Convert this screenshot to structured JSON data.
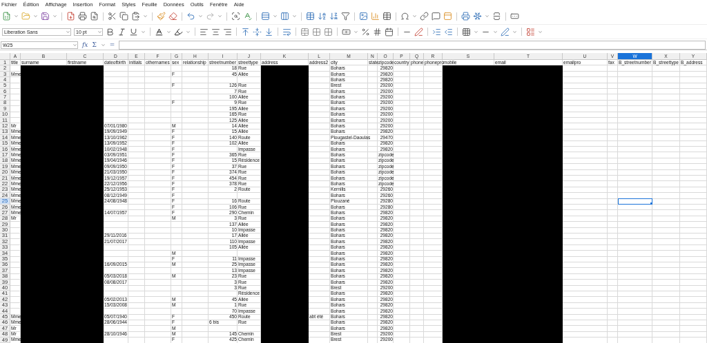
{
  "menu": [
    "Fichier",
    "Édition",
    "Affichage",
    "Insertion",
    "Format",
    "Styles",
    "Feuille",
    "Données",
    "Outils",
    "Fenêtre",
    "Aide"
  ],
  "formatting": {
    "font_name": "Liberation Sans",
    "font_size": "10 pt"
  },
  "formula_bar": {
    "name_box": "W25",
    "function_wizard": "fx",
    "sum": "Σ",
    "equals": "="
  },
  "columns": [
    {
      "letter": "A",
      "selected": false,
      "redacted": false
    },
    {
      "letter": "B",
      "selected": false,
      "redacted": true
    },
    {
      "letter": "C",
      "selected": false,
      "redacted": true
    },
    {
      "letter": "D",
      "selected": false,
      "redacted": false
    },
    {
      "letter": "E",
      "selected": false,
      "redacted": false
    },
    {
      "letter": "F",
      "selected": false,
      "redacted": false
    },
    {
      "letter": "G",
      "selected": false,
      "redacted": false
    },
    {
      "letter": "H",
      "selected": false,
      "redacted": false
    },
    {
      "letter": "I",
      "selected": false,
      "redacted": false
    },
    {
      "letter": "J",
      "selected": false,
      "redacted": false
    },
    {
      "letter": "K",
      "selected": false,
      "redacted": true
    },
    {
      "letter": "L",
      "selected": false,
      "redacted": false
    },
    {
      "letter": "M",
      "selected": false,
      "redacted": false
    },
    {
      "letter": "N",
      "selected": false,
      "redacted": false
    },
    {
      "letter": "O",
      "selected": false,
      "redacted": false
    },
    {
      "letter": "P",
      "selected": false,
      "redacted": false
    },
    {
      "letter": "Q",
      "selected": false,
      "redacted": false
    },
    {
      "letter": "R",
      "selected": false,
      "redacted": false
    },
    {
      "letter": "S",
      "selected": false,
      "redacted": true
    },
    {
      "letter": "T",
      "selected": false,
      "redacted": true
    },
    {
      "letter": "U",
      "selected": false,
      "redacted": false
    },
    {
      "letter": "V",
      "selected": false,
      "redacted": false
    },
    {
      "letter": "W",
      "selected": true,
      "redacted": false
    },
    {
      "letter": "X",
      "selected": false,
      "redacted": false
    },
    {
      "letter": "Y",
      "selected": false,
      "redacted": false
    }
  ],
  "header_row": {
    "number": "1",
    "selected": false,
    "cells": [
      "title",
      "surname",
      "firstname",
      "dateofbirth",
      "initials",
      "othernames",
      "sex",
      "relationship",
      "streetnumber",
      "streettype",
      "address",
      "address2",
      "city",
      "state",
      "zipcode",
      "country",
      "phone",
      "phonepro",
      "mobile",
      "email",
      "emailpro",
      "fax",
      "B_streetnumber",
      "B_streettype",
      "B_address"
    ]
  },
  "rows": [
    {
      "number": "2",
      "selected": false,
      "cells": [
        null,
        null,
        null,
        null,
        null,
        null,
        null,
        null,
        "18",
        "Rue",
        null,
        null,
        "Bohars",
        null,
        "29820",
        null,
        null,
        null,
        null,
        null,
        null,
        null,
        null,
        null,
        null
      ]
    },
    {
      "number": "3",
      "selected": false,
      "cells": [
        "Mme",
        null,
        null,
        null,
        null,
        null,
        "F",
        null,
        "45",
        "Allée",
        null,
        null,
        "Bohars",
        null,
        "29820",
        null,
        null,
        null,
        null,
        null,
        null,
        null,
        null,
        null,
        null
      ]
    },
    {
      "number": "4",
      "selected": false,
      "cells": [
        null,
        null,
        null,
        null,
        null,
        null,
        null,
        null,
        null,
        null,
        null,
        null,
        "Bohars",
        null,
        "29820",
        null,
        null,
        null,
        null,
        null,
        null,
        null,
        null,
        null,
        null
      ]
    },
    {
      "number": "5",
      "selected": false,
      "cells": [
        null,
        null,
        null,
        null,
        null,
        null,
        "F",
        null,
        "126",
        "Rue",
        null,
        null,
        "Brest",
        null,
        "29200",
        null,
        null,
        null,
        null,
        null,
        null,
        null,
        null,
        null,
        null
      ]
    },
    {
      "number": "6",
      "selected": false,
      "cells": [
        null,
        null,
        null,
        null,
        null,
        null,
        null,
        null,
        "7",
        "Rue",
        null,
        null,
        "Bohars",
        null,
        "29200",
        null,
        null,
        null,
        null,
        null,
        null,
        null,
        null,
        null,
        null
      ]
    },
    {
      "number": "7",
      "selected": false,
      "cells": [
        null,
        null,
        null,
        null,
        null,
        null,
        null,
        null,
        "100",
        "Allée",
        null,
        null,
        "Bohars",
        null,
        "29200",
        null,
        null,
        null,
        null,
        null,
        null,
        null,
        null,
        null,
        null
      ]
    },
    {
      "number": "8",
      "selected": false,
      "cells": [
        null,
        null,
        null,
        null,
        null,
        null,
        "F",
        null,
        "9",
        "Rue",
        null,
        null,
        "Bohars",
        null,
        "29200",
        null,
        null,
        null,
        null,
        null,
        null,
        null,
        null,
        null,
        null
      ]
    },
    {
      "number": "9",
      "selected": false,
      "cells": [
        null,
        null,
        null,
        null,
        null,
        null,
        null,
        null,
        "195",
        "Allée",
        null,
        null,
        "Bohars",
        null,
        "29200",
        null,
        null,
        null,
        null,
        null,
        null,
        null,
        null,
        null,
        null
      ]
    },
    {
      "number": "10",
      "selected": false,
      "cells": [
        null,
        null,
        null,
        null,
        null,
        null,
        null,
        null,
        "165",
        "Rue",
        null,
        null,
        "Bohars",
        null,
        "29200",
        null,
        null,
        null,
        null,
        null,
        null,
        null,
        null,
        null,
        null
      ]
    },
    {
      "number": "11",
      "selected": false,
      "cells": [
        null,
        null,
        null,
        null,
        null,
        null,
        null,
        null,
        "125",
        "Allée",
        null,
        null,
        "Bohars",
        null,
        "29200",
        null,
        null,
        null,
        null,
        null,
        null,
        null,
        null,
        null,
        null
      ]
    },
    {
      "number": "12",
      "selected": false,
      "cells": [
        "Mr",
        null,
        null,
        "07/01/1980",
        null,
        null,
        "M",
        null,
        "14",
        "Allée",
        null,
        null,
        "Bohars",
        null,
        "29200",
        null,
        null,
        null,
        null,
        null,
        null,
        null,
        null,
        null,
        null
      ]
    },
    {
      "number": "13",
      "selected": false,
      "cells": [
        "Mme",
        null,
        null,
        "19/09/1949",
        null,
        null,
        "F",
        null,
        "15",
        "Allée",
        null,
        null,
        "Bohars",
        null,
        "29820",
        null,
        null,
        null,
        null,
        null,
        null,
        null,
        null,
        null,
        null
      ]
    },
    {
      "number": "14",
      "selected": false,
      "cells": [
        "Mme",
        null,
        null,
        "13/10/1962",
        null,
        null,
        "F",
        null,
        "140",
        "Route",
        null,
        null,
        "Plougastel-Daoulas",
        null,
        "29470",
        null,
        null,
        null,
        null,
        null,
        null,
        null,
        null,
        null,
        null
      ]
    },
    {
      "number": "15",
      "selected": false,
      "cells": [
        "Mme",
        null,
        null,
        "13/09/1952",
        null,
        null,
        "F",
        null,
        "102",
        "Allée",
        null,
        null,
        "Bohars",
        null,
        "29820",
        null,
        null,
        null,
        null,
        null,
        null,
        null,
        null,
        null,
        null
      ]
    },
    {
      "number": "16",
      "selected": false,
      "cells": [
        "Mme",
        null,
        null,
        "10/02/1948",
        null,
        null,
        "F",
        null,
        null,
        "Impasse",
        null,
        null,
        "Bohars",
        null,
        "29820",
        null,
        null,
        null,
        null,
        null,
        null,
        null,
        null,
        null,
        null
      ]
    },
    {
      "number": "17",
      "selected": false,
      "cells": [
        "Mme",
        null,
        null,
        "03/09/1951",
        null,
        null,
        "F",
        null,
        "365",
        "Rue",
        null,
        null,
        "Bohars",
        null,
        "zipcode",
        null,
        null,
        null,
        null,
        null,
        null,
        null,
        null,
        null,
        null
      ]
    },
    {
      "number": "18",
      "selected": false,
      "cells": [
        "Mme",
        null,
        null,
        "19/04/1946",
        null,
        null,
        "F",
        null,
        "15",
        "Résidence",
        null,
        null,
        "Bohars",
        null,
        "zipcode",
        null,
        null,
        null,
        null,
        null,
        null,
        null,
        null,
        null,
        null
      ]
    },
    {
      "number": "19",
      "selected": false,
      "cells": [
        "Mme",
        null,
        null,
        "09/09/1950",
        null,
        null,
        "F",
        null,
        "37",
        "Rue",
        null,
        null,
        "Bohars",
        null,
        "zipcode",
        null,
        null,
        null,
        null,
        null,
        null,
        null,
        null,
        null,
        null
      ]
    },
    {
      "number": "20",
      "selected": false,
      "cells": [
        "Mme",
        null,
        null,
        "21/03/1950",
        null,
        null,
        "F",
        null,
        "374",
        "Rue",
        null,
        null,
        "Bohars",
        null,
        "zipcode",
        null,
        null,
        null,
        null,
        null,
        null,
        null,
        null,
        null,
        null
      ]
    },
    {
      "number": "21",
      "selected": false,
      "cells": [
        "Mme",
        null,
        null,
        "19/12/1957",
        null,
        null,
        "F",
        null,
        "454",
        "Rue",
        null,
        null,
        "Bohars",
        null,
        "zipcode",
        null,
        null,
        null,
        null,
        null,
        null,
        null,
        null,
        null,
        null
      ]
    },
    {
      "number": "22",
      "selected": false,
      "cells": [
        "Mme",
        null,
        null,
        "22/12/1956",
        null,
        null,
        "F",
        null,
        "378",
        "Rue",
        null,
        null,
        "Bohars",
        null,
        "zipcode",
        null,
        null,
        null,
        null,
        null,
        null,
        null,
        null,
        null,
        null
      ]
    },
    {
      "number": "23",
      "selected": false,
      "cells": [
        "Mme",
        null,
        null,
        "25/12/1953",
        null,
        null,
        "F",
        null,
        "2",
        "Route",
        null,
        null,
        "Kernilis",
        null,
        "29260",
        null,
        null,
        null,
        null,
        null,
        null,
        null,
        null,
        null,
        null
      ]
    },
    {
      "number": "24",
      "selected": false,
      "cells": [
        "Mme",
        null,
        null,
        "08/12/1949",
        null,
        null,
        "F",
        null,
        null,
        null,
        null,
        null,
        "Bohars",
        null,
        "29260",
        null,
        null,
        null,
        null,
        null,
        null,
        null,
        null,
        null,
        null
      ]
    },
    {
      "number": "25",
      "selected": true,
      "cells": [
        "Mme",
        null,
        null,
        "24/08/1948",
        null,
        null,
        "F",
        null,
        "16",
        "Route",
        null,
        null,
        "Plouzané",
        null,
        "29280",
        null,
        null,
        null,
        null,
        null,
        null,
        null,
        null,
        null,
        null
      ]
    },
    {
      "number": "26",
      "selected": false,
      "cells": [
        "Mme",
        null,
        null,
        null,
        null,
        null,
        "F",
        null,
        "106",
        "Rue",
        null,
        null,
        "Bohars",
        null,
        "29280",
        null,
        null,
        null,
        null,
        null,
        null,
        null,
        null,
        null,
        null
      ]
    },
    {
      "number": "27",
      "selected": false,
      "cells": [
        "Mme",
        null,
        null,
        "14/07/1957",
        null,
        null,
        "F",
        null,
        "290",
        "Chemin",
        null,
        null,
        "Bohars",
        null,
        "29820",
        null,
        null,
        null,
        null,
        null,
        null,
        null,
        null,
        null,
        null
      ]
    },
    {
      "number": "28",
      "selected": false,
      "cells": [
        "Mr",
        null,
        null,
        null,
        null,
        null,
        "M",
        null,
        "3",
        "Rue",
        null,
        null,
        "Bohars",
        null,
        "29820",
        null,
        null,
        null,
        null,
        null,
        null,
        null,
        null,
        null,
        null
      ]
    },
    {
      "number": "29",
      "selected": false,
      "cells": [
        null,
        null,
        null,
        null,
        null,
        null,
        null,
        null,
        "137",
        "Allée",
        null,
        null,
        "Bohars",
        null,
        "29820",
        null,
        null,
        null,
        null,
        null,
        null,
        null,
        null,
        null,
        null
      ]
    },
    {
      "number": "30",
      "selected": false,
      "cells": [
        null,
        null,
        null,
        null,
        null,
        null,
        null,
        null,
        "10",
        "Impasse",
        null,
        null,
        "Bohars",
        null,
        "29820",
        null,
        null,
        null,
        null,
        null,
        null,
        null,
        null,
        null,
        null
      ]
    },
    {
      "number": "31",
      "selected": false,
      "cells": [
        null,
        null,
        null,
        "29/11/2016",
        null,
        null,
        null,
        null,
        "17",
        "Allée",
        null,
        null,
        "Bohars",
        null,
        "29820",
        null,
        null,
        null,
        null,
        null,
        null,
        null,
        null,
        null,
        null
      ]
    },
    {
      "number": "32",
      "selected": false,
      "cells": [
        null,
        null,
        null,
        "21/07/2017",
        null,
        null,
        null,
        null,
        "110",
        "Impasse",
        null,
        null,
        "Bohars",
        null,
        "29820",
        null,
        null,
        null,
        null,
        null,
        null,
        null,
        null,
        null,
        null
      ]
    },
    {
      "number": "33",
      "selected": false,
      "cells": [
        null,
        null,
        null,
        null,
        null,
        null,
        null,
        null,
        "105",
        "Allée",
        null,
        null,
        "Bohars",
        null,
        "29820",
        null,
        null,
        null,
        null,
        null,
        null,
        null,
        null,
        null,
        null
      ]
    },
    {
      "number": "34",
      "selected": false,
      "cells": [
        null,
        null,
        null,
        null,
        null,
        null,
        "M",
        null,
        null,
        null,
        null,
        null,
        "Bohars",
        null,
        "29820",
        null,
        null,
        null,
        null,
        null,
        null,
        null,
        null,
        null,
        null
      ]
    },
    {
      "number": "35",
      "selected": false,
      "cells": [
        null,
        null,
        null,
        null,
        null,
        null,
        "F",
        null,
        "11",
        "Impasse",
        null,
        null,
        "Bohars",
        null,
        "29820",
        null,
        null,
        null,
        null,
        null,
        null,
        null,
        null,
        null,
        null
      ]
    },
    {
      "number": "36",
      "selected": false,
      "cells": [
        null,
        null,
        null,
        "16/09/2015",
        null,
        null,
        "M",
        null,
        "25",
        "Impasse",
        null,
        null,
        "Bohars",
        null,
        "29820",
        null,
        null,
        null,
        null,
        null,
        null,
        null,
        null,
        null,
        null
      ]
    },
    {
      "number": "37",
      "selected": false,
      "cells": [
        null,
        null,
        null,
        null,
        null,
        null,
        null,
        null,
        "13",
        "Impasse",
        null,
        null,
        "Bohars",
        null,
        "29820",
        null,
        null,
        null,
        null,
        null,
        null,
        null,
        null,
        null,
        null
      ]
    },
    {
      "number": "38",
      "selected": false,
      "cells": [
        null,
        null,
        null,
        "05/03/2018",
        null,
        null,
        "M",
        null,
        "23",
        "Rue",
        null,
        null,
        "Bohars",
        null,
        "29820",
        null,
        null,
        null,
        null,
        null,
        null,
        null,
        null,
        null,
        null
      ]
    },
    {
      "number": "39",
      "selected": false,
      "cells": [
        null,
        null,
        null,
        "08/08/2017",
        null,
        null,
        null,
        null,
        "3",
        "Rue",
        null,
        null,
        "Bohars",
        null,
        "29820",
        null,
        null,
        null,
        null,
        null,
        null,
        null,
        null,
        null,
        null
      ]
    },
    {
      "number": "40",
      "selected": false,
      "cells": [
        null,
        null,
        null,
        null,
        null,
        null,
        null,
        null,
        "3",
        "Rue",
        null,
        null,
        "Brest",
        null,
        "29200",
        null,
        null,
        null,
        null,
        null,
        null,
        null,
        null,
        null,
        null
      ]
    },
    {
      "number": "41",
      "selected": false,
      "cells": [
        null,
        null,
        null,
        null,
        null,
        null,
        null,
        null,
        null,
        "Résidence",
        null,
        null,
        "Bohars",
        null,
        "29820",
        null,
        null,
        null,
        null,
        null,
        null,
        null,
        null,
        null,
        null
      ]
    },
    {
      "number": "42",
      "selected": false,
      "cells": [
        null,
        null,
        null,
        "05/02/2013",
        null,
        null,
        "M",
        null,
        "45",
        "Allée",
        null,
        null,
        "Bohars",
        null,
        "29820",
        null,
        null,
        null,
        null,
        null,
        null,
        null,
        null,
        null,
        null
      ]
    },
    {
      "number": "43",
      "selected": false,
      "cells": [
        null,
        null,
        null,
        "15/03/2008",
        null,
        null,
        "M",
        null,
        "1",
        "Rue",
        null,
        null,
        "Bohars",
        null,
        "29820",
        null,
        null,
        null,
        null,
        null,
        null,
        null,
        null,
        null,
        null
      ]
    },
    {
      "number": "44",
      "selected": false,
      "cells": [
        null,
        null,
        null,
        null,
        null,
        null,
        null,
        null,
        "70",
        "Impasse",
        null,
        null,
        "Bohars",
        null,
        "29820",
        null,
        null,
        null,
        null,
        null,
        null,
        null,
        null,
        null,
        null
      ]
    },
    {
      "number": "45",
      "selected": false,
      "cells": [
        "Mme",
        null,
        null,
        "05/07/1940",
        null,
        null,
        "F",
        null,
        "450",
        "Route",
        null,
        "abt été",
        "Bohars",
        null,
        "29820",
        null,
        null,
        null,
        null,
        null,
        null,
        null,
        null,
        null,
        null
      ]
    },
    {
      "number": "46",
      "selected": false,
      "cells": [
        "Mme",
        null,
        null,
        "28/06/1944",
        null,
        null,
        "F",
        null,
        "6 bis",
        "Rue",
        null,
        null,
        "Bohars",
        null,
        "29820",
        null,
        null,
        null,
        null,
        null,
        null,
        null,
        null,
        null,
        null
      ]
    },
    {
      "number": "47",
      "selected": false,
      "cells": [
        "Mr",
        null,
        null,
        null,
        null,
        null,
        "M",
        null,
        null,
        null,
        null,
        null,
        "Bohars",
        null,
        "29820",
        null,
        null,
        null,
        null,
        null,
        null,
        null,
        null,
        null,
        null
      ]
    },
    {
      "number": "48",
      "selected": false,
      "cells": [
        "Mr",
        null,
        null,
        "28/10/1946",
        null,
        null,
        "M",
        null,
        "145",
        "Chemin",
        null,
        null,
        "Brest",
        null,
        "29200",
        null,
        null,
        null,
        null,
        null,
        null,
        null,
        null,
        null,
        null
      ]
    },
    {
      "number": "49",
      "selected": false,
      "cells": [
        "Mme",
        null,
        null,
        null,
        null,
        null,
        "F",
        null,
        "425",
        "Chemin",
        null,
        null,
        "Brest",
        null,
        "29200",
        null,
        null,
        null,
        null,
        null,
        null,
        null,
        null,
        null,
        null
      ]
    }
  ]
}
